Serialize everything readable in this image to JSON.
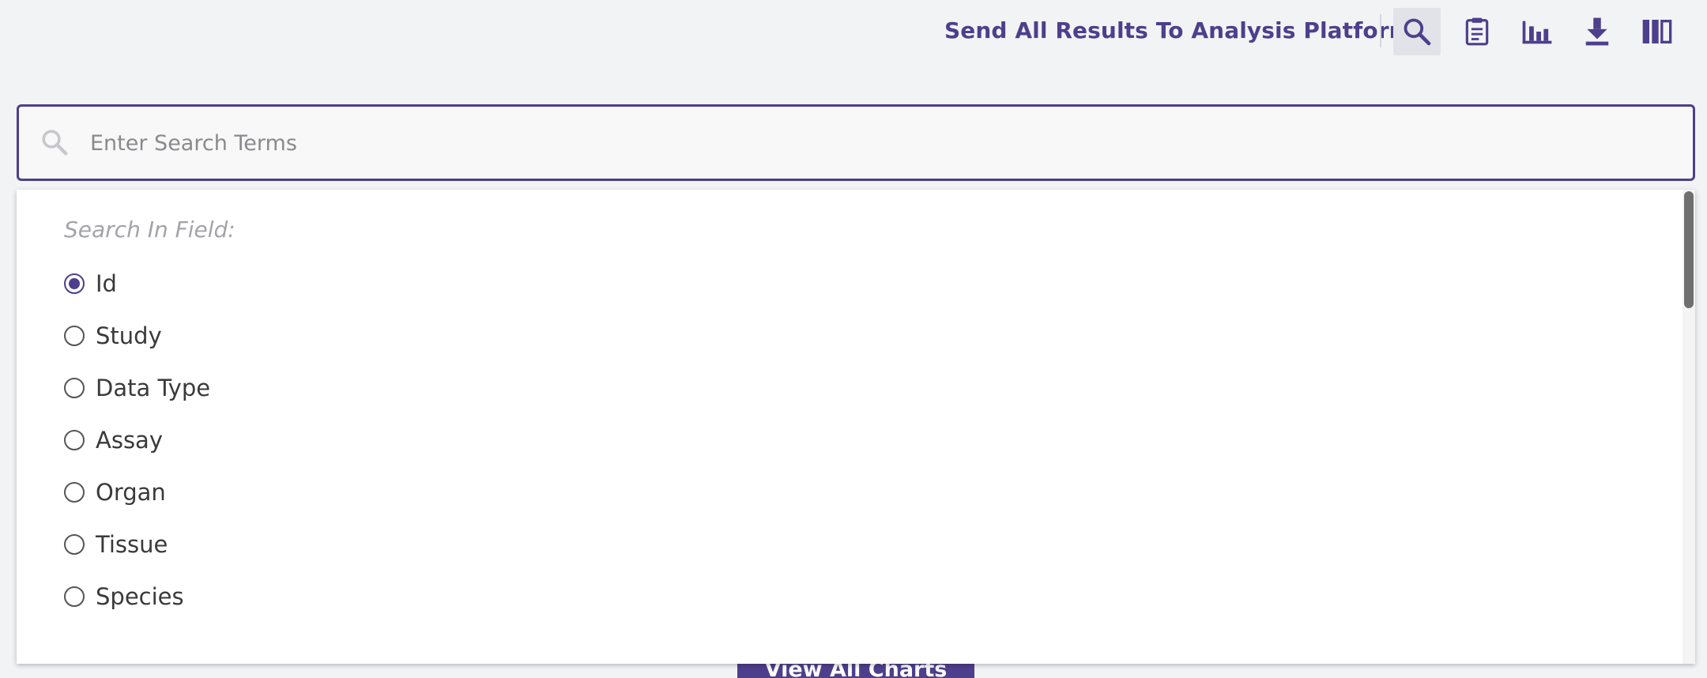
{
  "toolbar": {
    "send_label": "Send All Results To Analysis Platform",
    "icons": [
      "search-icon",
      "clipboard-icon",
      "bar-chart-icon",
      "download-icon",
      "columns-icon"
    ]
  },
  "search": {
    "placeholder": "Enter Search Terms",
    "value": ""
  },
  "dropdown": {
    "heading": "Search In Field:",
    "options": [
      {
        "label": "Id",
        "checked": true
      },
      {
        "label": "Study",
        "checked": false
      },
      {
        "label": "Data Type",
        "checked": false
      },
      {
        "label": "Assay",
        "checked": false
      },
      {
        "label": "Organ",
        "checked": false
      },
      {
        "label": "Tissue",
        "checked": false
      },
      {
        "label": "Species",
        "checked": false
      }
    ]
  },
  "background": {
    "view_charts_label": "View All Charts"
  },
  "colors": {
    "accent": "#4e3f8c",
    "page_bg": "#f2f3f5"
  }
}
